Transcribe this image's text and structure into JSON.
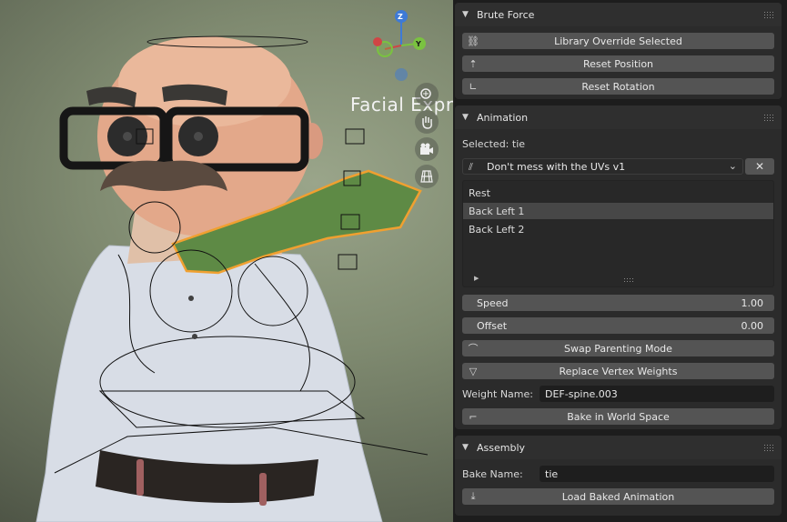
{
  "viewport": {
    "overlay_label": "Facial Expression",
    "gizmo": {
      "z_label": "Z",
      "y_label": "Y"
    },
    "nav_buttons": [
      "zoom-icon",
      "hand-pan-icon",
      "camera-icon",
      "grid-icon"
    ]
  },
  "brute_force": {
    "title": "Brute Force",
    "buttons": [
      {
        "label": "Library Override Selected",
        "icon": "link-broken-icon"
      },
      {
        "label": "Reset Position",
        "icon": "move-icon"
      },
      {
        "label": "Reset Rotation",
        "icon": "angle-icon"
      }
    ]
  },
  "animation": {
    "title": "Animation",
    "selected_text": "Selected: tie",
    "action_dropdown": {
      "value": "Don't mess with the UVs v1",
      "icon": "action-icon"
    },
    "clear_label": "✕",
    "list_items": [
      "Rest",
      "Back Left 1",
      "Back Left 2"
    ],
    "active_item_index": 1,
    "speed": {
      "label": "Speed",
      "value": "1.00"
    },
    "offset": {
      "label": "Offset",
      "value": "0.00"
    },
    "swap_parenting_label": "Swap Parenting Mode",
    "replace_weights_label": "Replace Vertex Weights",
    "weight_name_label": "Weight Name:",
    "weight_name_value": "DEF-spine.003",
    "bake_world_label": "Bake in World Space"
  },
  "assembly": {
    "title": "Assembly",
    "bake_name_label": "Bake Name:",
    "bake_name_value": "tie",
    "load_baked_label": "Load Baked Animation"
  },
  "colors": {
    "panel_bg": "#2b2b2b",
    "button_bg": "#545454",
    "selection_outline": "#f0a030",
    "tie_green": "#5e8a45",
    "gizmo_x": "#d04545",
    "gizmo_y": "#7ac240",
    "gizmo_z": "#3e7ad6"
  }
}
